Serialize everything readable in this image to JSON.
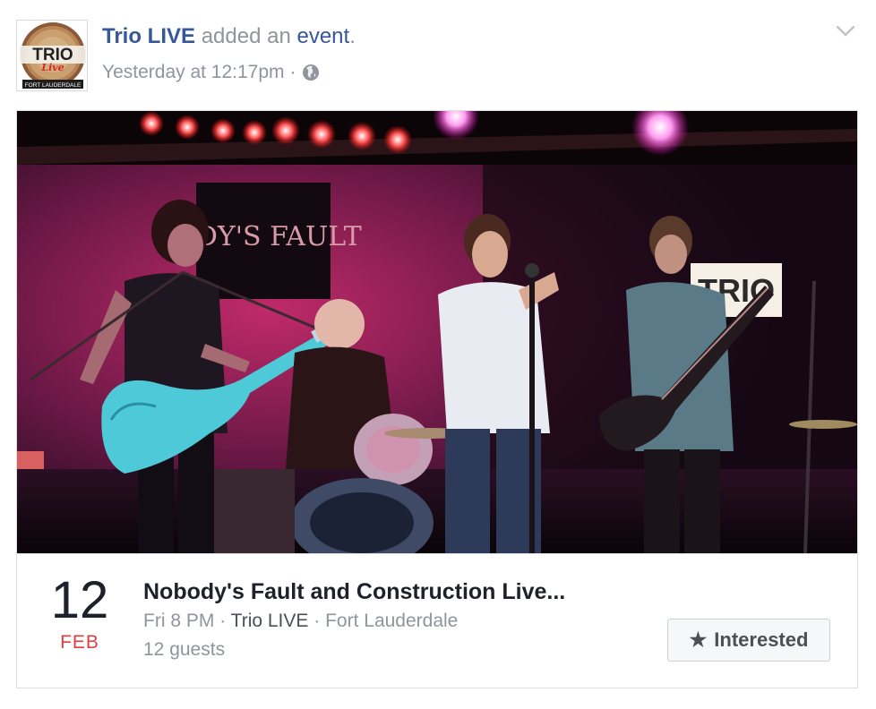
{
  "post": {
    "actor": "Trio LIVE",
    "verb": "added an",
    "object": "event",
    "period": ".",
    "timestamp": "Yesterday at 12:17pm",
    "separator": "·",
    "privacy_icon": "globe-icon",
    "menu_icon": "chevron-down-icon"
  },
  "avatar": {
    "line1": "TRIO",
    "line2": "Live",
    "line3": "FORT LAUDERDALE"
  },
  "cover": {
    "banner_text": "ODY'S FAULT",
    "sign_text": "TRIO"
  },
  "event": {
    "day": "12",
    "month": "FEB",
    "title": "Nobody's Fault and Construction Live...",
    "time": "Fri 8 PM",
    "host": "Trio LIVE",
    "location": "Fort Lauderdale",
    "dot": "·",
    "guests": "12 guests",
    "interested_label": "Interested",
    "interested_icon": "star-icon"
  },
  "colors": {
    "link": "#365899",
    "muted": "#90949c",
    "month": "#e03d3d",
    "border": "#dddfe2"
  }
}
